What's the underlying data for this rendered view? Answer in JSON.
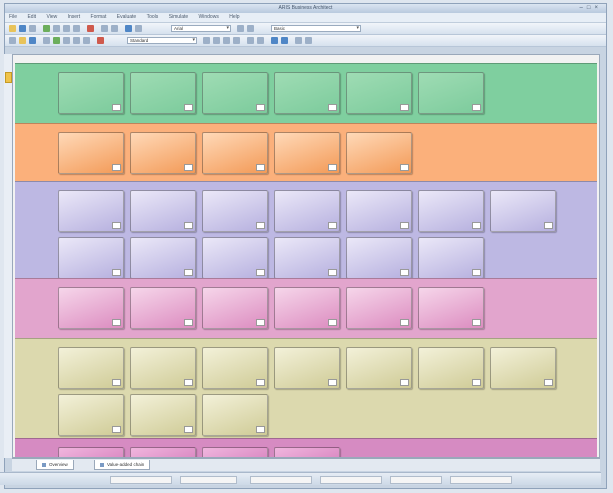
{
  "window": {
    "title": "ARIS Business Architect"
  },
  "menu": [
    "File",
    "Edit",
    "View",
    "Insert",
    "Format",
    "Evaluate",
    "Tools",
    "Simulate",
    "Windows",
    "Help"
  ],
  "toolbar1": {
    "font_combo": "Arial",
    "zoom_combo": "Basic"
  },
  "toolbar2": {
    "view_combo": "Standard"
  },
  "lanes": [
    {
      "label": "",
      "color_top": "#9fdcb4",
      "color_bottom": "#7ccb9c",
      "lane_bg": "#7fcf9f",
      "cards": [
        {
          "id": "",
          "name": ""
        },
        {
          "id": "",
          "name": ""
        },
        {
          "id": "",
          "name": ""
        },
        {
          "id": "",
          "name": ""
        },
        {
          "id": "",
          "name": ""
        },
        {
          "id": "",
          "name": ""
        }
      ]
    },
    {
      "label": "",
      "color_top": "#ffd9b8",
      "color_bottom": "#f39a57",
      "lane_bg": "#fbb07b",
      "cards": [
        {
          "id": "",
          "name": ""
        },
        {
          "id": "",
          "name": ""
        },
        {
          "id": "",
          "name": ""
        },
        {
          "id": "",
          "name": ""
        },
        {
          "id": "",
          "name": ""
        }
      ]
    },
    {
      "label": "",
      "color_top": "#ebe8f8",
      "color_bottom": "#b6b0df",
      "lane_bg": "#bdb8e3",
      "cards": [
        {
          "id": "",
          "name": ""
        },
        {
          "id": "",
          "name": ""
        },
        {
          "id": "",
          "name": ""
        },
        {
          "id": "",
          "name": ""
        },
        {
          "id": "",
          "name": ""
        },
        {
          "id": "",
          "name": ""
        },
        {
          "id": "",
          "name": ""
        },
        {
          "id": "",
          "name": ""
        },
        {
          "id": "",
          "name": ""
        },
        {
          "id": "",
          "name": ""
        },
        {
          "id": "",
          "name": ""
        },
        {
          "id": "",
          "name": ""
        },
        {
          "id": "",
          "name": ""
        }
      ]
    },
    {
      "label": "",
      "color_top": "#f6d6ea",
      "color_bottom": "#dc8cc0",
      "lane_bg": "#e2a5cd",
      "cards": [
        {
          "id": "",
          "name": ""
        },
        {
          "id": "",
          "name": ""
        },
        {
          "id": "",
          "name": ""
        },
        {
          "id": "",
          "name": ""
        },
        {
          "id": "",
          "name": ""
        },
        {
          "id": "",
          "name": ""
        }
      ]
    },
    {
      "label": "",
      "color_top": "#f3f1d9",
      "color_bottom": "#cfcb96",
      "lane_bg": "#dcd9ae",
      "cards": [
        {
          "id": "",
          "name": ""
        },
        {
          "id": "",
          "name": ""
        },
        {
          "id": "",
          "name": ""
        },
        {
          "id": "",
          "name": ""
        },
        {
          "id": "",
          "name": ""
        },
        {
          "id": "",
          "name": ""
        },
        {
          "id": "",
          "name": ""
        },
        {
          "id": "",
          "name": ""
        },
        {
          "id": "",
          "name": ""
        },
        {
          "id": "",
          "name": ""
        }
      ]
    },
    {
      "label": "",
      "color_top": "#f0b6de",
      "color_bottom": "#c864ac",
      "lane_bg": "#d68bc2",
      "cards": [
        {
          "id": "",
          "name": ""
        },
        {
          "id": "",
          "name": ""
        },
        {
          "id": "",
          "name": ""
        },
        {
          "id": "",
          "name": ""
        }
      ]
    }
  ],
  "tabs": [
    {
      "label": "Overview"
    },
    {
      "label": "Value-added chain"
    }
  ],
  "status": {
    "text": ""
  }
}
